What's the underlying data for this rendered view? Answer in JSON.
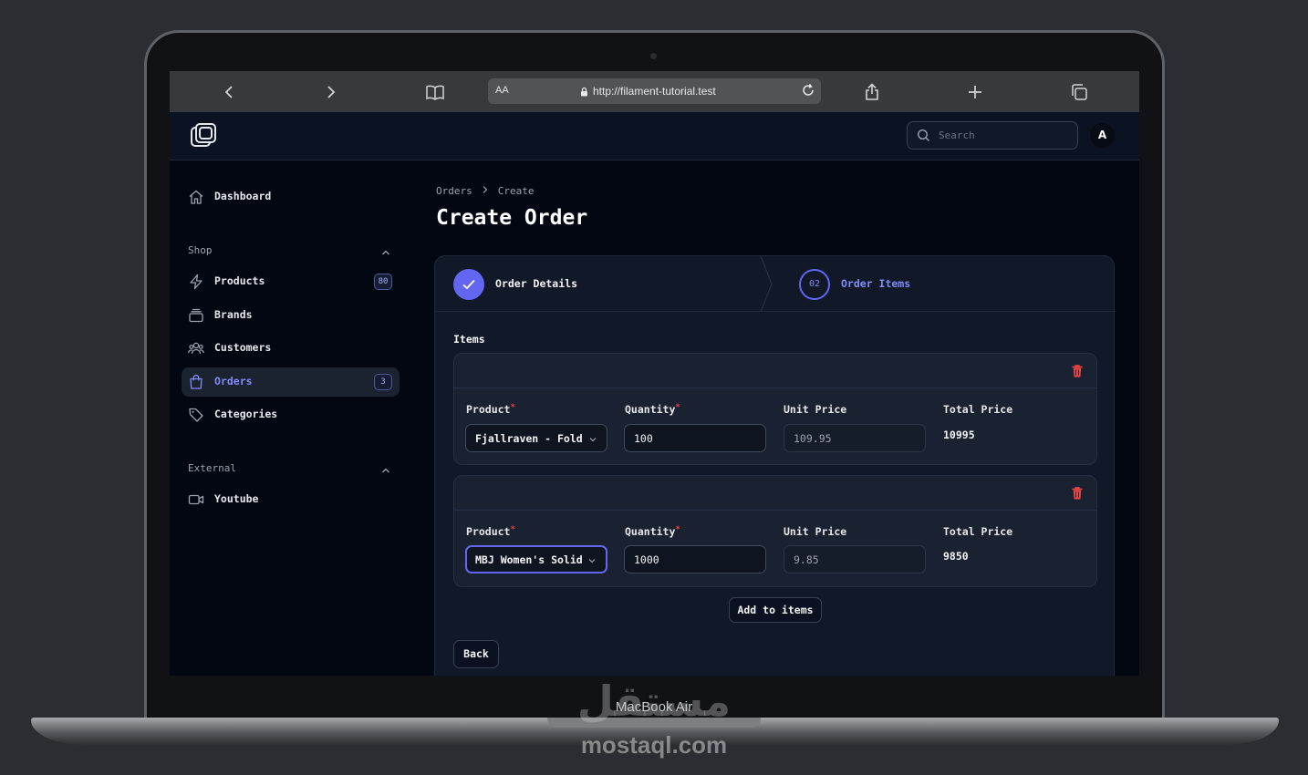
{
  "browser": {
    "text_size_label": "AA",
    "url": "http://filament-tutorial.test"
  },
  "header": {
    "search_placeholder": "Search",
    "avatar_initial": "A"
  },
  "sidebar": {
    "dashboard": "Dashboard",
    "groups": [
      {
        "label": "Shop"
      },
      {
        "label": "External"
      }
    ],
    "items": [
      {
        "label": "Products",
        "badge": "80"
      },
      {
        "label": "Brands"
      },
      {
        "label": "Customers"
      },
      {
        "label": "Orders",
        "badge": "3"
      },
      {
        "label": "Categories"
      },
      {
        "label": "Youtube"
      }
    ]
  },
  "main": {
    "breadcrumb": [
      "Orders",
      "Create"
    ],
    "title": "Create Order",
    "wizard": {
      "steps": [
        {
          "number": "",
          "label": "Order Details",
          "state": "completed"
        },
        {
          "number": "02",
          "label": "Order Items",
          "state": "current"
        }
      ]
    },
    "items_label": "Items",
    "columns": {
      "product": "Product",
      "quantity": "Quantity",
      "unit_price": "Unit Price",
      "total_price": "Total Price"
    },
    "rows": [
      {
        "product": "Fjallraven - Fold",
        "quantity": "100",
        "unit_price": "109.95",
        "total_price": "10995"
      },
      {
        "product": "MBJ Women's Solid",
        "quantity": "1000",
        "unit_price": "9.85",
        "total_price": "9850"
      }
    ],
    "add_button": "Add to items",
    "back_button": "Back"
  },
  "device": {
    "model_label": "MacBook Air"
  },
  "watermark": {
    "arabic": "مستقل",
    "latin": "mostaql.com"
  },
  "colors": {
    "accent": "#6366f1",
    "danger": "#ef4444",
    "background": "#030712"
  }
}
